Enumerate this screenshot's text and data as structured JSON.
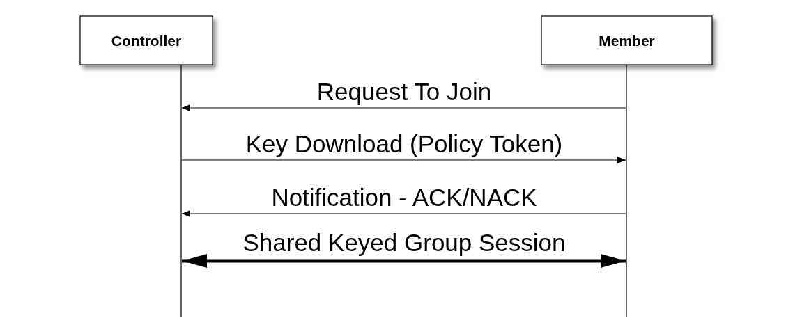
{
  "participants": [
    {
      "name": "Controller"
    },
    {
      "name": "Member"
    }
  ],
  "messages": [
    {
      "label": "Request To Join",
      "head_left": true,
      "head_right": false,
      "kind": "message"
    },
    {
      "label": "Key Download (Policy Token)",
      "head_left": false,
      "head_right": true,
      "kind": "message"
    },
    {
      "label": "Notification - ACK/NACK",
      "head_left": true,
      "head_right": false,
      "kind": "message"
    },
    {
      "label": "Shared Keyed Group Session",
      "head_left": true,
      "head_right": true,
      "kind": "session"
    }
  ]
}
